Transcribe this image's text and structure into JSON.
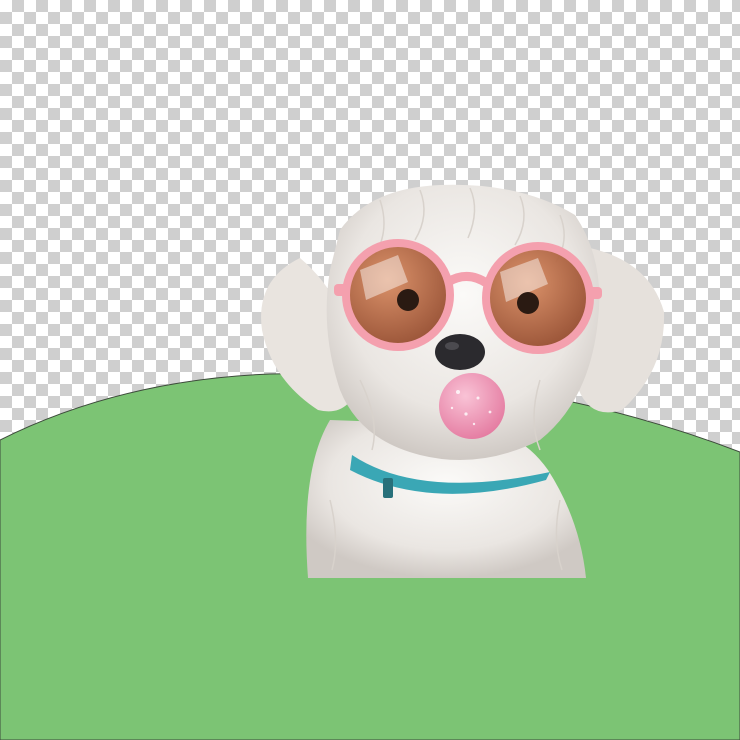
{
  "image": {
    "subject": "dog-with-sunglasses-and-bubblegum",
    "background": "transparency-checkerboard",
    "colors": {
      "checker_light": "#ffffff",
      "checker_dark": "#cfcfcf",
      "ground_green": "#7cc474",
      "fur_white": "#f1eeea",
      "fur_shadow": "#c9c3bf",
      "glasses_pink": "#f4a0ae",
      "lens_tint": "#b7603e",
      "bubble_pink": "#ef8fb2",
      "collar_teal": "#3aa7b5",
      "nose_dark": "#2b2a2e"
    }
  }
}
